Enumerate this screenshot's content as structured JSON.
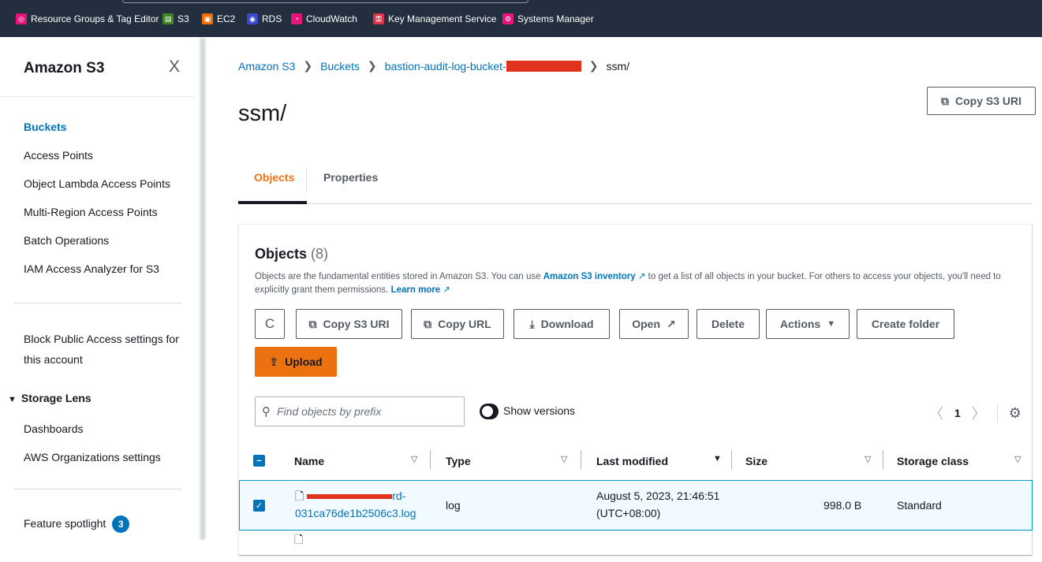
{
  "topbar": {
    "favorites": [
      {
        "label": "Resource Groups & Tag Editor",
        "icon": "resource-groups-icon",
        "color": "#e7157b"
      },
      {
        "label": "S3",
        "icon": "s3-icon",
        "color": "#3f8624"
      },
      {
        "label": "EC2",
        "icon": "ec2-icon",
        "color": "#ed7100"
      },
      {
        "label": "RDS",
        "icon": "rds-icon",
        "color": "#3b48cc"
      },
      {
        "label": "CloudWatch",
        "icon": "cloudwatch-icon",
        "color": "#e7157b"
      },
      {
        "label": "Key Management Service",
        "icon": "kms-icon",
        "color": "#dd344c"
      },
      {
        "label": "Systems Manager",
        "icon": "systems-manager-icon",
        "color": "#e7157b"
      }
    ]
  },
  "sidebar": {
    "title": "Amazon S3",
    "close_glyph": "X",
    "items": [
      {
        "label": "Buckets",
        "active": true
      },
      {
        "label": "Access Points"
      },
      {
        "label": "Object Lambda Access Points"
      },
      {
        "label": "Multi-Region Access Points"
      },
      {
        "label": "Batch Operations"
      },
      {
        "label": "IAM Access Analyzer for S3"
      }
    ],
    "block_public_access": "Block Public Access settings for this account",
    "storage_lens": {
      "label": "Storage Lens",
      "expanded": true,
      "items": [
        {
          "label": "Dashboards"
        },
        {
          "label": "AWS Organizations settings"
        }
      ]
    },
    "feature_spotlight": {
      "label": "Feature spotlight",
      "count": "3"
    }
  },
  "breadcrumb": {
    "items": [
      "Amazon S3",
      "Buckets",
      "bastion-audit-log-bucket-"
    ],
    "current": "ssm/"
  },
  "page": {
    "title": "ssm/",
    "copy_s3_uri": "Copy S3 URI"
  },
  "tabs": [
    {
      "label": "Objects",
      "active": true
    },
    {
      "label": "Properties",
      "active": false
    }
  ],
  "objects_panel": {
    "heading": "Objects",
    "count": "(8)",
    "desc_part1": "Objects are the fundamental entities stored in Amazon S3. You can use ",
    "inventory_link": "Amazon S3 inventory",
    "desc_part2": " to get a list of all objects in your bucket. For others to access your objects, you'll need to explicitly grant them permissions. ",
    "learn_more": "Learn more",
    "toolbar": {
      "refresh": "C",
      "copy_s3_uri": "Copy S3 URI",
      "copy_url": "Copy URL",
      "download": "Download",
      "open": "Open",
      "delete": "Delete",
      "actions": "Actions",
      "create_folder": "Create folder",
      "upload": "Upload"
    },
    "search_placeholder": "Find objects by prefix",
    "show_versions": "Show versions",
    "page_number": "1",
    "columns": [
      "Name",
      "Type",
      "Last modified",
      "Size",
      "Storage class"
    ],
    "rows": [
      {
        "name_prefix": "",
        "name_suffix": "rd-",
        "name_line2": "031ca76de1b2506c3.log",
        "type": "log",
        "last_modified": "August 5, 2023, 21:46:51",
        "last_modified_tz": "(UTC+08:00)",
        "size": "998.0 B",
        "storage_class": "Standard",
        "selected": true
      }
    ]
  }
}
